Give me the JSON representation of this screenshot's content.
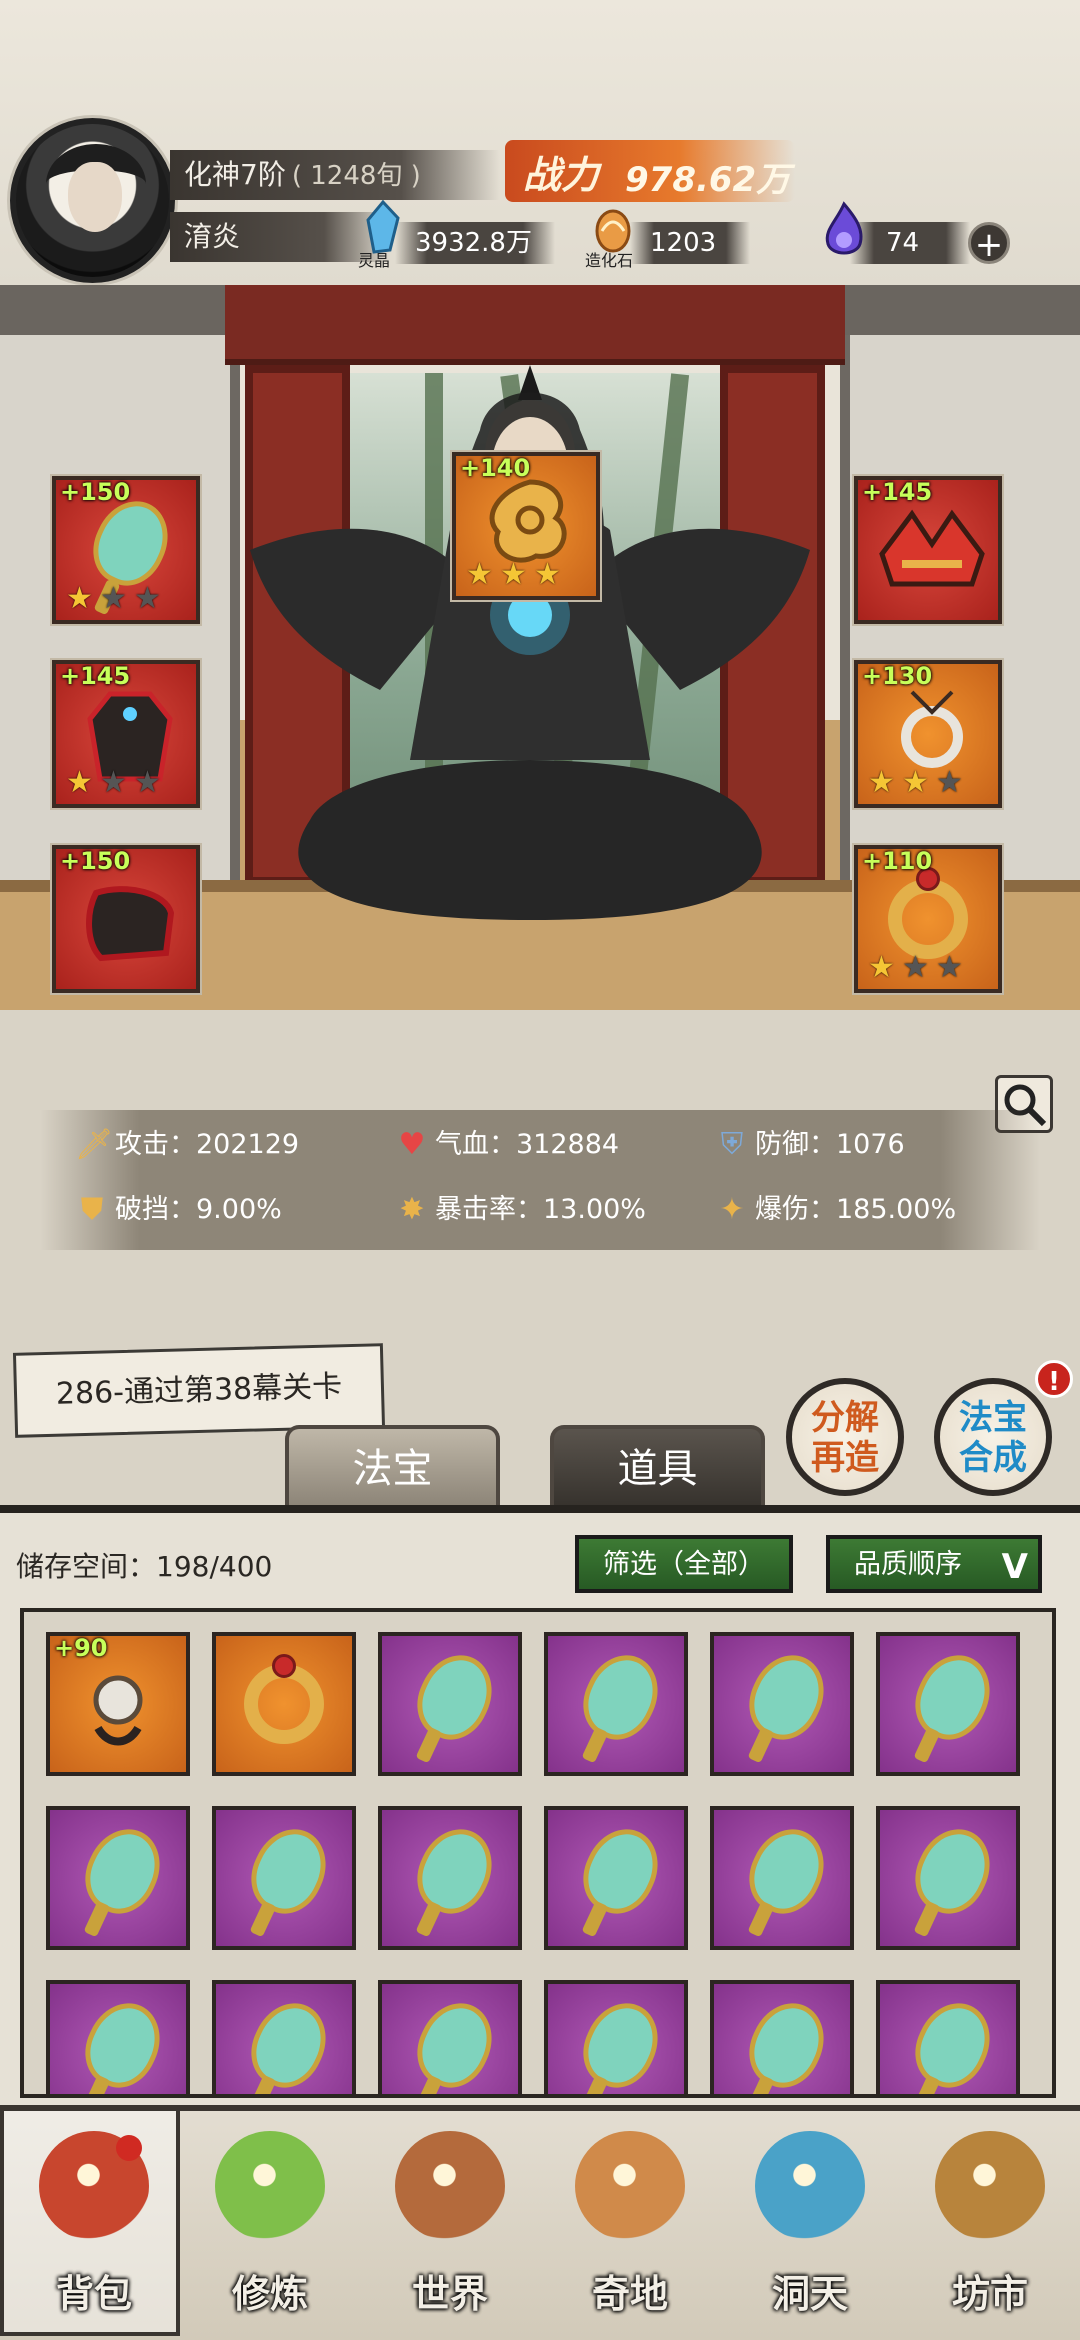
{
  "header": {
    "realm": "化神7阶",
    "realm_sub": "( 1248旬 )",
    "player_name": "淯炎",
    "power_label": "战力",
    "power_value": "978.62万",
    "resources": [
      {
        "name": "灵晶",
        "value": "3932.8万",
        "icon": "spirit-crystal-icon",
        "color": "#5db7e8"
      },
      {
        "name": "造化石",
        "value": "1203",
        "icon": "creation-stone-icon",
        "color": "#e99b45"
      },
      {
        "name": "",
        "value": "74",
        "icon": "purple-flame-icon",
        "color": "#6b4bd8"
      }
    ],
    "add_label": "+"
  },
  "equipment": {
    "left": [
      {
        "level": "+150",
        "stars": 1,
        "item": "jade-fan",
        "bg": "red"
      },
      {
        "level": "+145",
        "stars": 1,
        "item": "robe",
        "bg": "red"
      },
      {
        "level": "+150",
        "stars": 0,
        "item": "boots",
        "bg": "red"
      }
    ],
    "center": {
      "level": "+140",
      "stars": 3,
      "item": "golden-cloud-charm",
      "bg": "orange"
    },
    "right": [
      {
        "level": "+145",
        "stars": 0,
        "item": "crown",
        "bg": "red"
      },
      {
        "level": "+130",
        "stars": 2,
        "item": "pendant",
        "bg": "orange"
      },
      {
        "level": "+110",
        "stars": 1,
        "item": "ring",
        "bg": "orange"
      }
    ]
  },
  "stats": {
    "attack": "攻击：202129",
    "hp": "气血：312884",
    "defense": "防御：1076",
    "block_break": "破挡：9.00%",
    "crit_rate": "暴击率：13.00%",
    "crit_damage": "爆伤：185.00%"
  },
  "stage": "286-通过第38幕关卡",
  "actions": {
    "decompose_line1": "分解",
    "decompose_line2": "再造",
    "synthesize_line1": "法宝",
    "synthesize_line2": "合成",
    "alert": "!"
  },
  "tabs": {
    "treasure": "法宝",
    "items": "道具"
  },
  "inventory": {
    "storage": "储存空间：198/400",
    "filter": "筛选（全部）",
    "sort": "品质顺序",
    "items": [
      {
        "kind": "pendant",
        "bg": "orange",
        "level": "+90"
      },
      {
        "kind": "ring",
        "bg": "orange",
        "level": ""
      },
      {
        "kind": "fan",
        "bg": "purple",
        "level": ""
      },
      {
        "kind": "fan",
        "bg": "purple",
        "level": ""
      },
      {
        "kind": "fan",
        "bg": "purple",
        "level": ""
      },
      {
        "kind": "fan",
        "bg": "purple",
        "level": ""
      },
      {
        "kind": "fan",
        "bg": "purple",
        "level": ""
      },
      {
        "kind": "fan",
        "bg": "purple",
        "level": ""
      },
      {
        "kind": "fan",
        "bg": "purple",
        "level": ""
      },
      {
        "kind": "fan",
        "bg": "purple",
        "level": ""
      },
      {
        "kind": "fan",
        "bg": "purple",
        "level": ""
      },
      {
        "kind": "fan",
        "bg": "purple",
        "level": ""
      },
      {
        "kind": "fan",
        "bg": "purple",
        "level": ""
      },
      {
        "kind": "fan",
        "bg": "purple",
        "level": ""
      },
      {
        "kind": "fan",
        "bg": "purple",
        "level": ""
      },
      {
        "kind": "fan",
        "bg": "purple",
        "level": ""
      },
      {
        "kind": "fan",
        "bg": "purple",
        "level": ""
      },
      {
        "kind": "fan",
        "bg": "purple",
        "level": ""
      }
    ]
  },
  "nav": [
    {
      "label": "背包",
      "icon": "bag-icon",
      "color": "#c8462e"
    },
    {
      "label": "修炼",
      "icon": "lotus-icon",
      "color": "#7fbf4a"
    },
    {
      "label": "世界",
      "icon": "scroll-map-icon",
      "color": "#b46a3c"
    },
    {
      "label": "奇地",
      "icon": "pagoda-icon",
      "color": "#d08a4a"
    },
    {
      "label": "洞天",
      "icon": "portal-icon",
      "color": "#4aa2c8"
    },
    {
      "label": "坊市",
      "icon": "market-stall-icon",
      "color": "#b8843c"
    }
  ]
}
